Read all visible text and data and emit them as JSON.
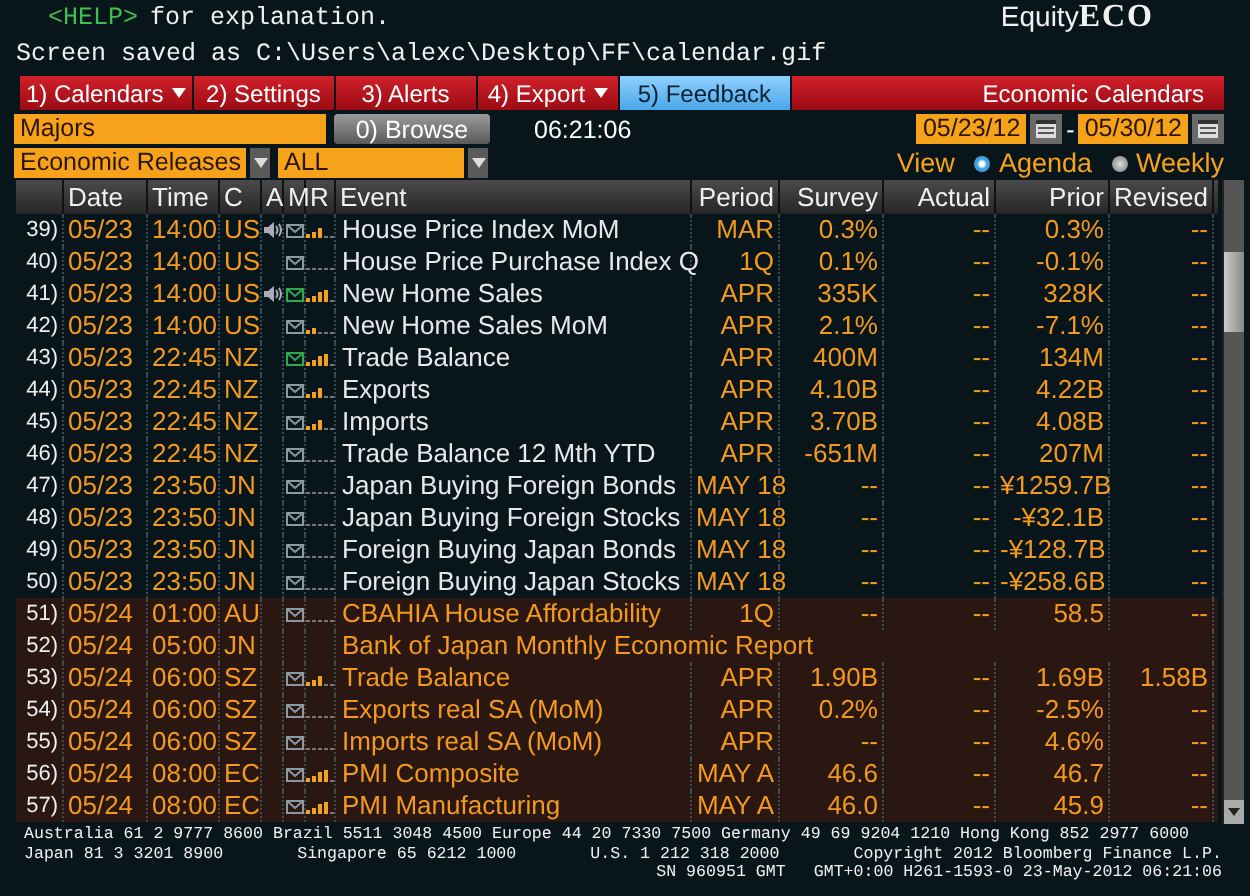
{
  "help_line": {
    "key": "<HELP>",
    "text": "for explanation."
  },
  "product": {
    "prefix": "Equity",
    "name": "ECO"
  },
  "status_line": "Screen saved as C:\\Users\\alexc\\Desktop\\FF\\calendar.gif",
  "toolbar": {
    "buttons": [
      {
        "label": "1) Calendars",
        "kind": "menu",
        "dropdown": true
      },
      {
        "label": "2) Settings",
        "kind": "menu",
        "dropdown": false
      },
      {
        "label": "3) Alerts",
        "kind": "menu",
        "dropdown": false
      },
      {
        "label": "4) Export",
        "kind": "menu",
        "dropdown": true
      },
      {
        "label": "5) Feedback",
        "kind": "feedback",
        "dropdown": false
      }
    ],
    "title": "Economic Calendars"
  },
  "filters": {
    "region": "Majors",
    "browse": "0) Browse",
    "clock": "06:21:06",
    "start_date": "05/23/12",
    "separator": "-",
    "end_date": "05/30/12",
    "category": "Economic Releases",
    "subcategory": "ALL",
    "view_label": "View",
    "view_options": [
      {
        "label": "Agenda",
        "selected": true
      },
      {
        "label": "Weekly",
        "selected": false
      }
    ]
  },
  "table": {
    "columns": [
      "Date",
      "Time",
      "C",
      "A",
      "M",
      "R",
      "Event",
      "Period",
      "Survey",
      "Actual",
      "Prior",
      "Revised"
    ],
    "rows": [
      {
        "number": "39)",
        "date": "05/23",
        "time": "14:00",
        "country": "US",
        "alert": true,
        "mail": true,
        "mail_flagged": false,
        "bars": [
          true,
          true,
          true,
          false,
          false
        ],
        "event": "House Price Index MoM",
        "period": "MAR",
        "survey": "0.3%",
        "actual": "--",
        "prior": "0.3%",
        "revised": "--",
        "highlighted": false
      },
      {
        "number": "40)",
        "date": "05/23",
        "time": "14:00",
        "country": "US",
        "alert": false,
        "mail": true,
        "mail_flagged": false,
        "bars": [
          false,
          false,
          false,
          false,
          false
        ],
        "event": "House Price Purchase Index Q",
        "period": "1Q",
        "survey": "0.1%",
        "actual": "--",
        "prior": "-0.1%",
        "revised": "--",
        "highlighted": false
      },
      {
        "number": "41)",
        "date": "05/23",
        "time": "14:00",
        "country": "US",
        "alert": true,
        "mail": true,
        "mail_flagged": true,
        "bars": [
          true,
          true,
          true,
          true,
          false
        ],
        "event": "New Home Sales",
        "period": "APR",
        "survey": "335K",
        "actual": "--",
        "prior": "328K",
        "revised": "--",
        "highlighted": false
      },
      {
        "number": "42)",
        "date": "05/23",
        "time": "14:00",
        "country": "US",
        "alert": false,
        "mail": true,
        "mail_flagged": false,
        "bars": [
          true,
          true,
          false,
          false,
          false
        ],
        "event": "New Home Sales MoM",
        "period": "APR",
        "survey": "2.1%",
        "actual": "--",
        "prior": "-7.1%",
        "revised": "--",
        "highlighted": false
      },
      {
        "number": "43)",
        "date": "05/23",
        "time": "22:45",
        "country": "NZ",
        "alert": false,
        "mail": true,
        "mail_flagged": true,
        "bars": [
          true,
          true,
          true,
          true,
          false
        ],
        "event": "Trade Balance",
        "period": "APR",
        "survey": "400M",
        "actual": "--",
        "prior": "134M",
        "revised": "--",
        "highlighted": false
      },
      {
        "number": "44)",
        "date": "05/23",
        "time": "22:45",
        "country": "NZ",
        "alert": false,
        "mail": true,
        "mail_flagged": false,
        "bars": [
          true,
          true,
          true,
          false,
          false
        ],
        "event": "Exports",
        "period": "APR",
        "survey": "4.10B",
        "actual": "--",
        "prior": "4.22B",
        "revised": "--",
        "highlighted": false
      },
      {
        "number": "45)",
        "date": "05/23",
        "time": "22:45",
        "country": "NZ",
        "alert": false,
        "mail": true,
        "mail_flagged": false,
        "bars": [
          true,
          true,
          true,
          false,
          false
        ],
        "event": "Imports",
        "period": "APR",
        "survey": "3.70B",
        "actual": "--",
        "prior": "4.08B",
        "revised": "--",
        "highlighted": false
      },
      {
        "number": "46)",
        "date": "05/23",
        "time": "22:45",
        "country": "NZ",
        "alert": false,
        "mail": true,
        "mail_flagged": false,
        "bars": [
          false,
          false,
          false,
          false,
          false
        ],
        "event": "Trade Balance 12 Mth YTD",
        "period": "APR",
        "survey": "-651M",
        "actual": "--",
        "prior": "207M",
        "revised": "--",
        "highlighted": false
      },
      {
        "number": "47)",
        "date": "05/23",
        "time": "23:50",
        "country": "JN",
        "alert": false,
        "mail": true,
        "mail_flagged": false,
        "bars": [
          false,
          false,
          false,
          false,
          false
        ],
        "event": "Japan Buying Foreign Bonds",
        "period": "MAY 18",
        "survey": "--",
        "actual": "--",
        "prior": "¥1259.7B",
        "revised": "--",
        "highlighted": false
      },
      {
        "number": "48)",
        "date": "05/23",
        "time": "23:50",
        "country": "JN",
        "alert": false,
        "mail": true,
        "mail_flagged": false,
        "bars": [
          false,
          false,
          false,
          false,
          false
        ],
        "event": "Japan Buying Foreign Stocks",
        "period": "MAY 18",
        "survey": "--",
        "actual": "--",
        "prior": "-¥32.1B",
        "revised": "--",
        "highlighted": false
      },
      {
        "number": "49)",
        "date": "05/23",
        "time": "23:50",
        "country": "JN",
        "alert": false,
        "mail": true,
        "mail_flagged": false,
        "bars": [
          false,
          false,
          false,
          false,
          false
        ],
        "event": "Foreign Buying Japan Bonds",
        "period": "MAY 18",
        "survey": "--",
        "actual": "--",
        "prior": "-¥128.7B",
        "revised": "--",
        "highlighted": false
      },
      {
        "number": "50)",
        "date": "05/23",
        "time": "23:50",
        "country": "JN",
        "alert": false,
        "mail": true,
        "mail_flagged": false,
        "bars": [
          false,
          false,
          false,
          false,
          false
        ],
        "event": "Foreign Buying Japan Stocks",
        "period": "MAY 18",
        "survey": "--",
        "actual": "--",
        "prior": "-¥258.6B",
        "revised": "--",
        "highlighted": false
      },
      {
        "number": "51)",
        "date": "05/24",
        "time": "01:00",
        "country": "AU",
        "alert": false,
        "mail": true,
        "mail_flagged": false,
        "bars": [
          false,
          false,
          false,
          false,
          false
        ],
        "event": "CBAHIA House Affordability",
        "period": "1Q",
        "survey": "--",
        "actual": "--",
        "prior": "58.5",
        "revised": "--",
        "highlighted": true
      },
      {
        "number": "52)",
        "date": "05/24",
        "time": "05:00",
        "country": "JN",
        "alert": false,
        "mail": false,
        "event": "Bank of Japan Monthly Economic Report",
        "highlighted": true
      },
      {
        "number": "53)",
        "date": "05/24",
        "time": "06:00",
        "country": "SZ",
        "alert": false,
        "mail": true,
        "mail_flagged": false,
        "bars": [
          true,
          true,
          true,
          false,
          false
        ],
        "event": "Trade Balance",
        "period": "APR",
        "survey": "1.90B",
        "actual": "--",
        "prior": "1.69B",
        "revised": "1.58B",
        "highlighted": true
      },
      {
        "number": "54)",
        "date": "05/24",
        "time": "06:00",
        "country": "SZ",
        "alert": false,
        "mail": true,
        "mail_flagged": false,
        "bars": [
          false,
          false,
          false,
          false,
          false
        ],
        "event": "Exports real SA (MoM)",
        "period": "APR",
        "survey": "0.2%",
        "actual": "--",
        "prior": "-2.5%",
        "revised": "--",
        "highlighted": true
      },
      {
        "number": "55)",
        "date": "05/24",
        "time": "06:00",
        "country": "SZ",
        "alert": false,
        "mail": true,
        "mail_flagged": false,
        "bars": [
          false,
          false,
          false,
          false,
          false
        ],
        "event": "Imports real SA (MoM)",
        "period": "APR",
        "survey": "--",
        "actual": "--",
        "prior": "4.6%",
        "revised": "--",
        "highlighted": true
      },
      {
        "number": "56)",
        "date": "05/24",
        "time": "08:00",
        "country": "EC",
        "alert": false,
        "mail": true,
        "mail_flagged": false,
        "bars": [
          true,
          true,
          true,
          true,
          false
        ],
        "event": "PMI Composite",
        "period": "MAY A",
        "survey": "46.6",
        "actual": "--",
        "prior": "46.7",
        "revised": "--",
        "highlighted": true
      },
      {
        "number": "57)",
        "date": "05/24",
        "time": "08:00",
        "country": "EC",
        "alert": false,
        "mail": true,
        "mail_flagged": false,
        "bars": [
          true,
          true,
          true,
          true,
          false
        ],
        "event": "PMI Manufacturing",
        "period": "MAY A",
        "survey": "46.0",
        "actual": "--",
        "prior": "45.9",
        "revised": "--",
        "highlighted": true
      }
    ]
  },
  "footer": {
    "lines": [
      [
        "Australia 61 2 9777 8600 Brazil 5511 3048 4500 Europe 44 20 7330 7500 Germany 49 69 9204 1210 Hong Kong 852 2977 6000"
      ],
      [
        "Japan 81 3 3201 8900",
        "Singapore 65 6212 1000",
        "U.S. 1 212 318 2000",
        "Copyright 2012 Bloomberg Finance L.P."
      ],
      [
        "SN 960951 GMT",
        "GMT+0:00 H261-1593-0 23-May-2012 06:21:06"
      ]
    ]
  }
}
